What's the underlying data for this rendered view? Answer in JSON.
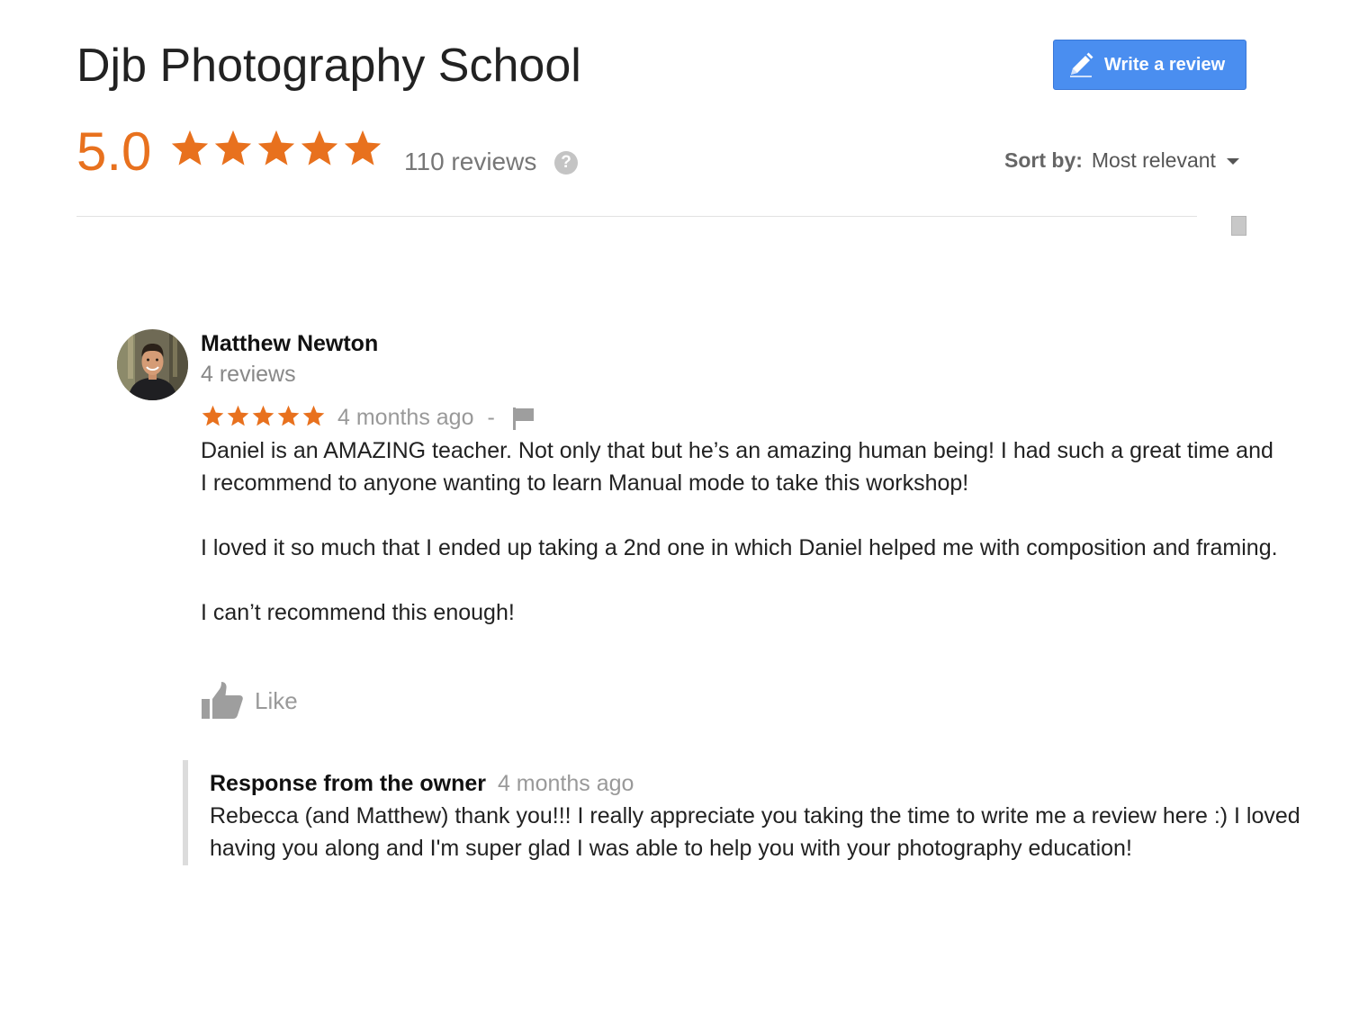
{
  "header": {
    "business_name": "Djb Photography School",
    "write_review_label": "Write a review",
    "rating": "5.0",
    "rating_value": 5,
    "max_rating": 5,
    "review_count": "110 reviews",
    "help_label": "?",
    "sort_label": "Sort by:",
    "sort_value": "Most relevant"
  },
  "colors": {
    "star": "#e8711e",
    "rating_text": "#e8711e",
    "button": "#4a8ef0"
  },
  "review": {
    "author": "Matthew Newton",
    "author_reviews": "4 reviews",
    "stars": 5,
    "time": "4 months ago",
    "separator": "-",
    "paragraphs": [
      "Daniel is an AMAZING teacher. Not only that but he’s an amazing human being! I had such a great time and I recommend to anyone wanting to learn Manual mode to take this workshop!",
      "I loved it so much that I ended up taking a 2nd one in which Daniel helped me with composition and framing.",
      "I can’t recommend this enough!"
    ],
    "like_label": "Like"
  },
  "response": {
    "title": "Response from the owner",
    "time": "4 months ago",
    "text": "Rebecca (and Matthew) thank you!!! I really appreciate you taking the time to write me a review here :) I loved having you along and I'm super glad I was able to help you with your photography education!"
  },
  "icons": {
    "write": "pencil-icon",
    "help": "help-icon",
    "sort": "caret-down-icon",
    "flag": "flag-icon",
    "like": "thumbs-up-icon",
    "star": "star-icon"
  }
}
